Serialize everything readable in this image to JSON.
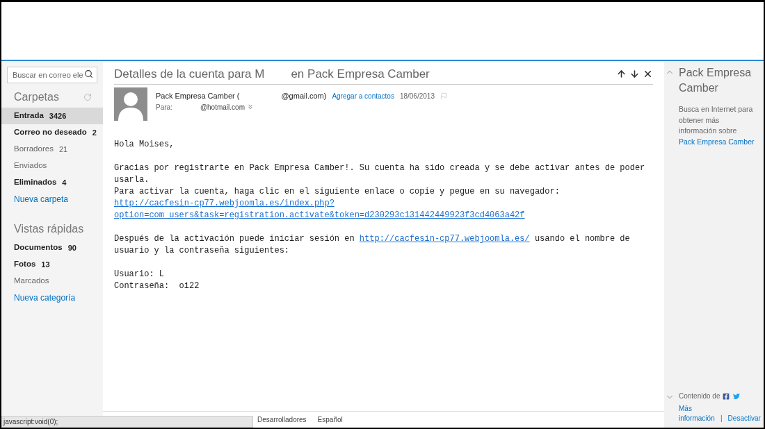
{
  "search": {
    "placeholder": "Buscar en correo ele"
  },
  "folders": {
    "title": "Carpetas",
    "items": [
      {
        "label": "Entrada",
        "count": "3426",
        "unread": true,
        "selected": true
      },
      {
        "label": "Correo no deseado",
        "count": "2",
        "unread": true,
        "selected": false
      },
      {
        "label": "Borradores",
        "count": "21",
        "unread": false,
        "selected": false
      },
      {
        "label": "Enviados",
        "unread": false,
        "selected": false
      },
      {
        "label": "Eliminados",
        "count": "4",
        "unread": true,
        "selected": false
      }
    ],
    "new_link": "Nueva carpeta"
  },
  "quick_views": {
    "title": "Vistas rápidas",
    "items": [
      {
        "label": "Documentos",
        "count": "90",
        "unread": true,
        "selected": false
      },
      {
        "label": "Fotos",
        "count": "13",
        "unread": true,
        "selected": false
      },
      {
        "label": "Marcados",
        "unread": false,
        "selected": false
      }
    ],
    "new_link": "Nueva categoría"
  },
  "message": {
    "subject_start": "Detalles de la cuenta para M",
    "subject_end": "en Pack Empresa Camber",
    "sender_start": "Pack Empresa Camber (",
    "sender_end": "@gmail.com)",
    "add_contact": "Agregar a contactos",
    "date": "18/06/2013",
    "to_label": "Para:",
    "to_address": "@hotmail.com",
    "body": [
      {
        "lines": [
          {
            "segments": [
              {
                "text": "Hola Moises,",
                "link": false
              }
            ]
          }
        ]
      },
      {
        "lines": [
          {
            "segments": [
              {
                "text": "Gracias por registrarte en Pack Empresa Camber!. Su cuenta ha sido creada y se debe activar antes de poder",
                "link": false
              }
            ]
          },
          {
            "segments": [
              {
                "text": "usarla.",
                "link": false
              }
            ]
          },
          {
            "segments": [
              {
                "text": "Para activar la cuenta, haga clic en el siguiente enlace o copie y pegue en su navegador:",
                "link": false
              }
            ]
          },
          {
            "segments": [
              {
                "text": "http://cacfesin-cp77.webjoomla.es/index.php?",
                "link": true
              }
            ]
          },
          {
            "segments": [
              {
                "text": "option=com_users&task=registration.activate&token=d230293c131442449923f3cd4063a42f",
                "link": true
              }
            ]
          }
        ]
      },
      {
        "lines": [
          {
            "segments": [
              {
                "text": "Después de la activación puede iniciar sesión en ",
                "link": false
              },
              {
                "text": "http://cacfesin-cp77.webjoomla.es/",
                "link": true
              },
              {
                "text": " usando el nombre de",
                "link": false
              }
            ]
          },
          {
            "segments": [
              {
                "text": "usuario y la contraseña siguientes:",
                "link": false
              }
            ]
          }
        ]
      },
      {
        "lines": [
          {
            "segments": [
              {
                "text": "Usuario: L",
                "link": false
              }
            ]
          },
          {
            "segments": [
              {
                "text": "Contraseña:  oi22",
                "link": false
              }
            ]
          }
        ]
      }
    ]
  },
  "footer": [
    "Desarrolladores",
    "Español"
  ],
  "side_panel": {
    "title": "Pack Empresa Camber",
    "description": "Busca en Internet para obtener más información sobre",
    "link": "Pack Empresa Camber",
    "content_from": "Contenido de",
    "more_info": "Más información",
    "separator": "|",
    "disable": "Desactivar"
  },
  "status_bar": "javascript:void(0);"
}
